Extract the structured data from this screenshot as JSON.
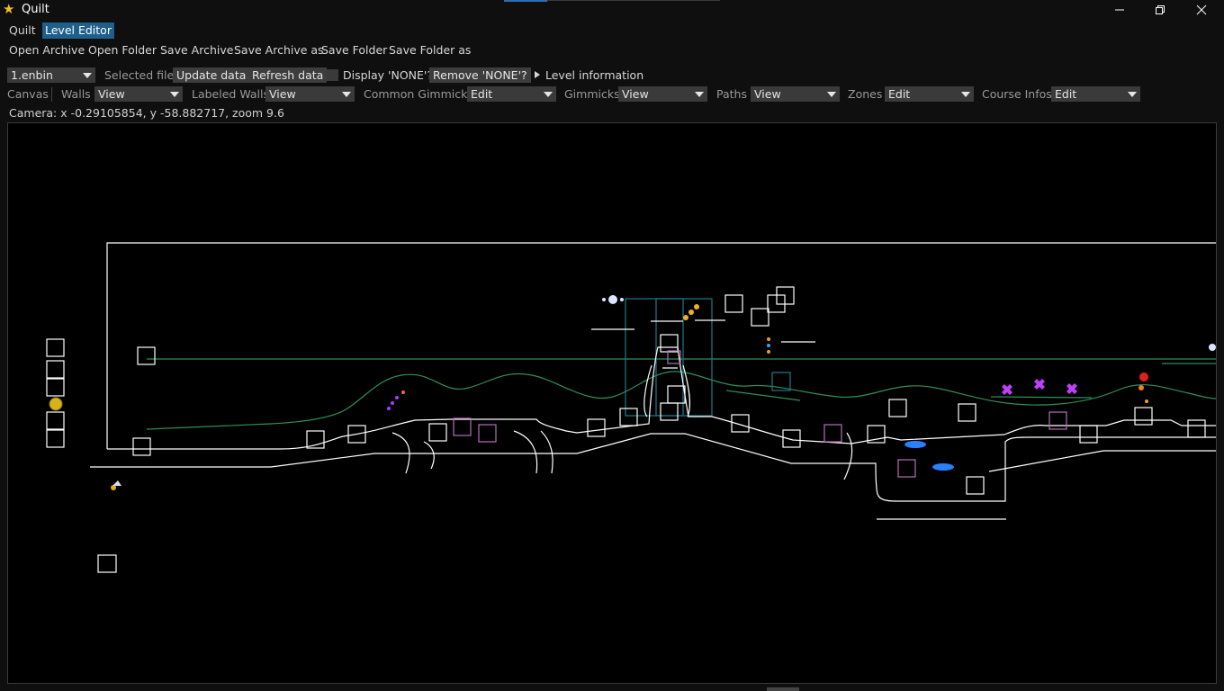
{
  "window": {
    "title": "Quilt",
    "app_icon": "star-icon",
    "controls": [
      "minimize-icon",
      "maximize-icon",
      "close-icon"
    ]
  },
  "menu": {
    "items": [
      "Quilt",
      "Level Editor"
    ],
    "active": "Level Editor"
  },
  "file_toolbar": {
    "open_archive": "Open Archive",
    "open_folder": "Open Folder",
    "save_archive": "Save Archive",
    "save_archive_as": "Save Archive as",
    "save_folder": "Save Folder",
    "save_folder_as": "Save Folder as"
  },
  "file_row": {
    "file_select": "1.enbin",
    "selected_file_label": "Selected file",
    "update_data": "Update data",
    "refresh_data": "Refresh data",
    "display_none": "Display 'NONE'?",
    "display_none_checked": false,
    "remove_none": "Remove 'NONE'?",
    "level_information": "Level information"
  },
  "layers_row": {
    "canvas": "Canvas",
    "walls": {
      "label": "Walls",
      "value": "View"
    },
    "labeled_walls": {
      "label": "Labeled Walls",
      "value": "View"
    },
    "common_gimmicks": {
      "label": "Common Gimmicks",
      "value": "Edit"
    },
    "gimmicks": {
      "label": "Gimmicks",
      "value": "View"
    },
    "paths": {
      "label": "Paths",
      "value": "View"
    },
    "zones": {
      "label": "Zones",
      "value": "Edit"
    },
    "course_infos": {
      "label": "Course Infos",
      "value": "Edit"
    }
  },
  "camera_status": "Camera: x -0.29105854, y -58.882717, zoom 9.6",
  "colors": {
    "background": "#0f0f0f",
    "canvas_bg": "#000000",
    "active_menu": "#1f5f8b",
    "walls": "#ffffff",
    "paths": "#2f8f5a",
    "zones": "#1f7a8a",
    "gimmick_boxes": "#b86fb8",
    "title_accent": "#2b6fb3"
  }
}
